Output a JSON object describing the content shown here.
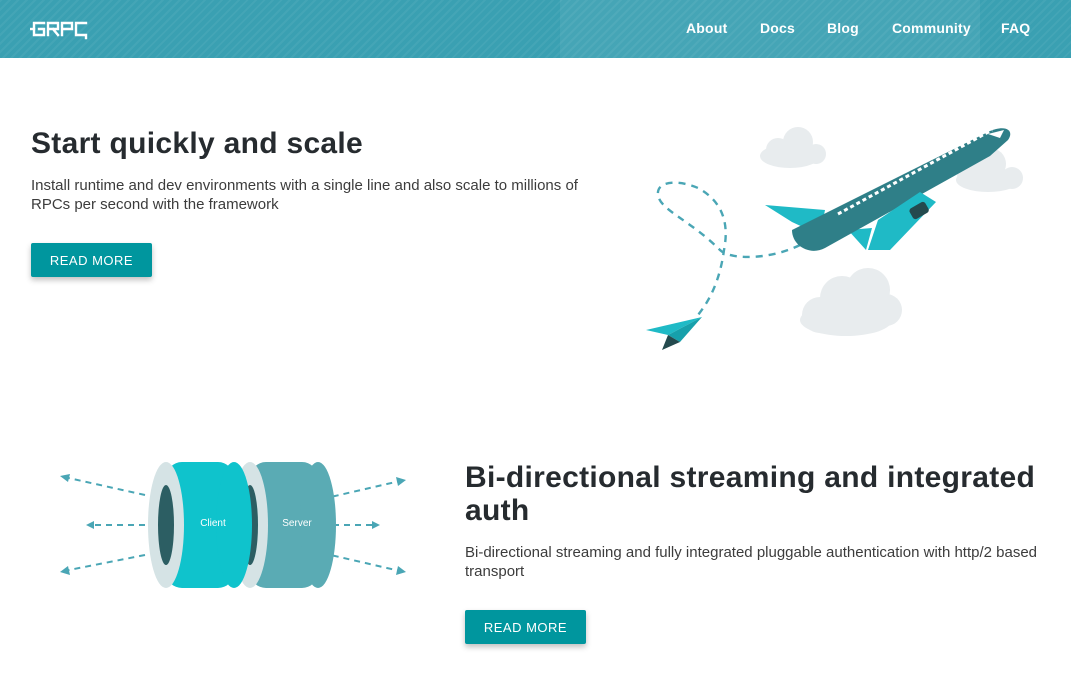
{
  "header": {
    "logo_text": "GRPC",
    "nav": [
      {
        "label": "About"
      },
      {
        "label": "Docs"
      },
      {
        "label": "Blog"
      },
      {
        "label": "Community"
      },
      {
        "label": "FAQ"
      }
    ]
  },
  "features": [
    {
      "title": "Start quickly and scale",
      "description": "Install runtime and dev environments with a single line and also scale to millions of RPCs per second with the framework",
      "button": "READ MORE",
      "illustration": "airplane-and-paper-plane"
    },
    {
      "title": "Bi-directional streaming and integrated auth",
      "description": "Bi-directional streaming and fully integrated pluggable authentication with http/2 based transport",
      "button": "READ MORE",
      "illustration": "client-server-rings",
      "labels": {
        "client": "Client",
        "server": "Server"
      }
    }
  ],
  "colors": {
    "header": "#3aa0b2",
    "button": "#00969e",
    "teal_light": "#1dbfcb",
    "teal_dark": "#2e7f86",
    "cloud": "#e8ecee"
  }
}
